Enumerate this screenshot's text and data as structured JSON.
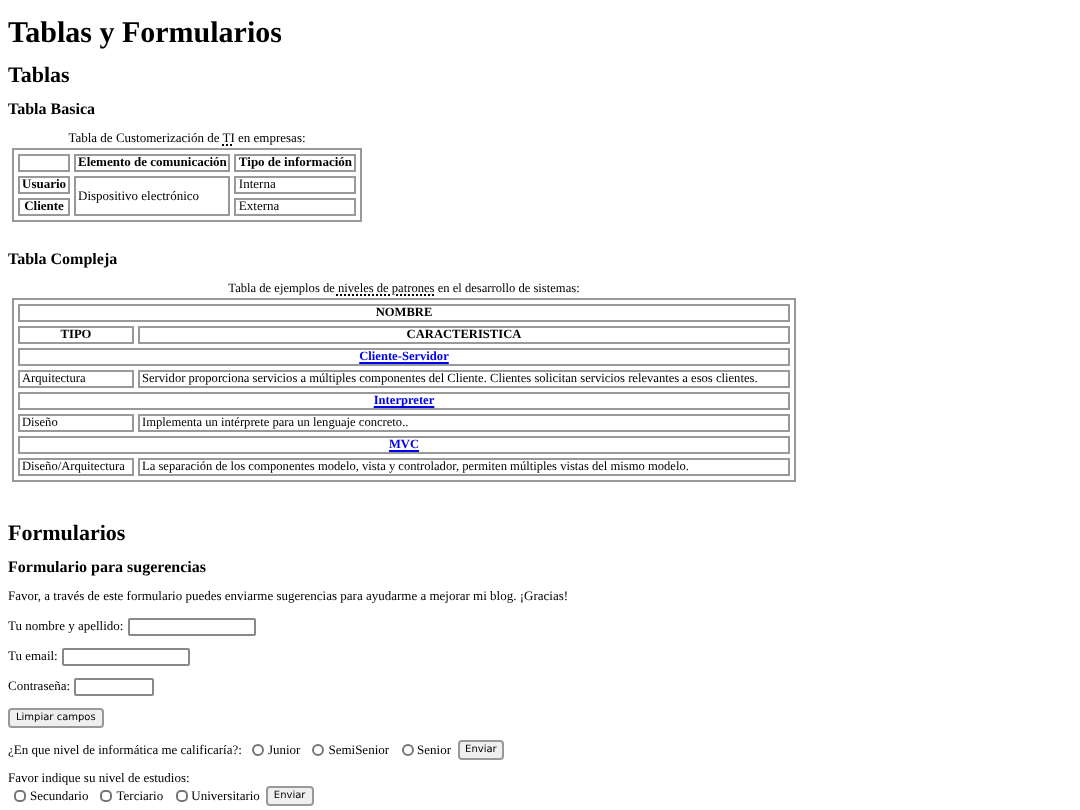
{
  "title": "Tablas y Formularios",
  "tables_section": {
    "heading": "Tablas",
    "basic": {
      "heading": "Tabla Basica",
      "caption": {
        "before": "Tabla de Customerización de ",
        "abbr": "TI",
        "after": " en empresas:"
      },
      "columns": [
        "Elemento de comunicación",
        "Tipo de información"
      ],
      "shared_cell": "Dispositivo electrónico",
      "rows": [
        {
          "header": "Usuario",
          "info_type": "Interna"
        },
        {
          "header": "Cliente",
          "info_type": "Externa"
        }
      ]
    },
    "complex": {
      "heading": "Tabla Compleja",
      "caption": {
        "before": "Tabla de ejemplos de ",
        "abbr": "niveles de patrones",
        "after": " en el desarrollo de sistemas:"
      },
      "title_header": "NOMBRE",
      "columns": [
        "TIPO",
        "CARACTERISTICA"
      ],
      "groups": [
        {
          "name": "Cliente-Servidor",
          "type": "Arquitectura",
          "characteristic": "Servidor proporciona servicios a múltiples componentes del Cliente. Clientes solicitan servicios relevantes a esos clientes."
        },
        {
          "name": "Interpreter",
          "type": "Diseño",
          "characteristic": "Implementa un intérprete para un lenguaje concreto.."
        },
        {
          "name": "MVC",
          "type": "Diseño/Arquitectura",
          "characteristic": "La separación de los componentes modelo, vista y controlador, permiten múltiples vistas del mismo modelo."
        }
      ]
    }
  },
  "forms_section": {
    "heading": "Formularios",
    "subheading": "Formulario para sugerencias",
    "intro": "Favor, a través de este formulario puedes enviarme sugerencias para ayudarme a mejorar mi blog. ¡Gracias!",
    "fields": [
      {
        "label": "Tu nombre y apellido:"
      },
      {
        "label": "Tu email:"
      },
      {
        "label": "Contraseña:"
      }
    ],
    "clear_button": "Limpiar campos",
    "level_question": {
      "label": "¿En que nivel de informática me calificaría?:",
      "options": [
        {
          "label": "Junior",
          "selected": false
        },
        {
          "label": "SemiSenior",
          "selected": false
        },
        {
          "label": "Senior",
          "selected": false
        }
      ],
      "button": "Enviar"
    },
    "studies_question": {
      "label": "Favor indique su nivel de estudios:",
      "options": [
        {
          "label": "Secundario",
          "checked": false
        },
        {
          "label": "Terciario",
          "checked": false
        },
        {
          "label": "Universitario",
          "checked": false
        }
      ],
      "button": "Enviar"
    }
  }
}
